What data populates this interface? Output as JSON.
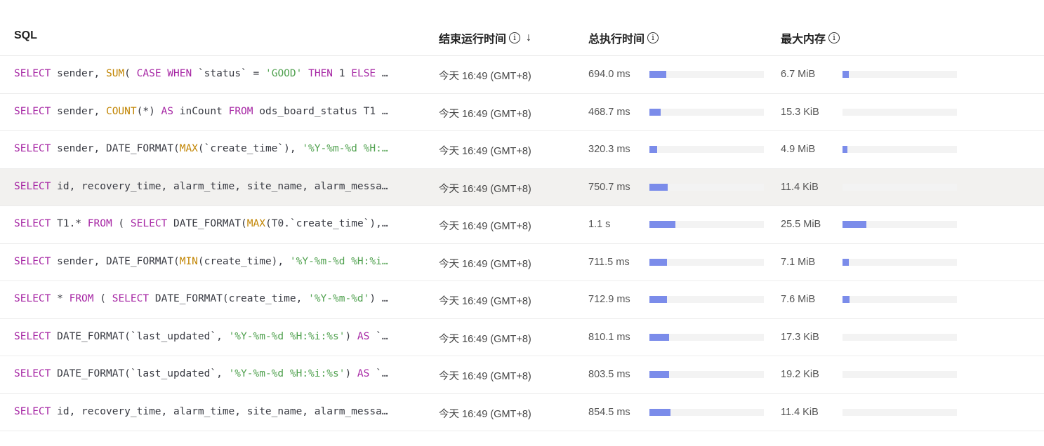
{
  "header": {
    "sql": "SQL",
    "end_time": "结束运行时间",
    "exec_time": "总执行时间",
    "max_mem": "最大内存",
    "info_glyph": "i",
    "sort_glyph": "↓"
  },
  "colors": {
    "keyword": "#a626a4",
    "function": "#c18401",
    "string": "#50a14f",
    "bar": "#7b8cea",
    "track": "#f3f3f3",
    "highlight": "#f2f1ef"
  },
  "rows": [
    {
      "sql": [
        [
          "kw",
          "SELECT"
        ],
        [
          "t",
          " sender, "
        ],
        [
          "fn",
          "SUM"
        ],
        [
          "t",
          "( "
        ],
        [
          "kw",
          "CASE WHEN"
        ],
        [
          "t",
          " `status` = "
        ],
        [
          "str",
          "'GOOD'"
        ],
        [
          "t",
          " "
        ],
        [
          "kw",
          "THEN"
        ],
        [
          "t",
          " 1 "
        ],
        [
          "kw",
          "ELSE"
        ],
        [
          "t",
          " …"
        ]
      ],
      "time": "今天 16:49 (GMT+8)",
      "exec": "694.0 ms",
      "exec_frac": 0.148,
      "mem": "6.7 MiB",
      "mem_frac": 0.055
    },
    {
      "sql": [
        [
          "kw",
          "SELECT"
        ],
        [
          "t",
          " sender, "
        ],
        [
          "fn",
          "COUNT"
        ],
        [
          "t",
          "(*) "
        ],
        [
          "kw",
          "AS"
        ],
        [
          "t",
          " inCount "
        ],
        [
          "kw",
          "FROM"
        ],
        [
          "t",
          " ods_board_status T1 …"
        ]
      ],
      "time": "今天 16:49 (GMT+8)",
      "exec": "468.7 ms",
      "exec_frac": 0.1,
      "mem": "15.3 KiB",
      "mem_frac": 0
    },
    {
      "sql": [
        [
          "kw",
          "SELECT"
        ],
        [
          "t",
          " sender, DATE_FORMAT("
        ],
        [
          "fn",
          "MAX"
        ],
        [
          "t",
          "(`create_time`), "
        ],
        [
          "str",
          "'%Y-%m-%d %H:…"
        ]
      ],
      "time": "今天 16:49 (GMT+8)",
      "exec": "320.3 ms",
      "exec_frac": 0.068,
      "mem": "4.9 MiB",
      "mem_frac": 0.04
    },
    {
      "sql": [
        [
          "kw",
          "SELECT"
        ],
        [
          "t",
          " id, recovery_time, alarm_time, site_name, alarm_messa…"
        ]
      ],
      "time": "今天 16:49 (GMT+8)",
      "exec": "750.7 ms",
      "exec_frac": 0.16,
      "mem": "11.4 KiB",
      "mem_frac": 0,
      "highlight": true
    },
    {
      "sql": [
        [
          "kw",
          "SELECT"
        ],
        [
          "t",
          " T1.* "
        ],
        [
          "kw",
          "FROM"
        ],
        [
          "t",
          " ( "
        ],
        [
          "kw",
          "SELECT"
        ],
        [
          "t",
          " DATE_FORMAT("
        ],
        [
          "fn",
          "MAX"
        ],
        [
          "t",
          "(T0.`create_time`),…"
        ]
      ],
      "time": "今天 16:49 (GMT+8)",
      "exec": "1.1 s",
      "exec_frac": 0.228,
      "mem": "25.5 MiB",
      "mem_frac": 0.21
    },
    {
      "sql": [
        [
          "kw",
          "SELECT"
        ],
        [
          "t",
          " sender, DATE_FORMAT("
        ],
        [
          "fn",
          "MIN"
        ],
        [
          "t",
          "(create_time), "
        ],
        [
          "str",
          "'%Y-%m-%d %H:%i…"
        ]
      ],
      "time": "今天 16:49 (GMT+8)",
      "exec": "711.5 ms",
      "exec_frac": 0.152,
      "mem": "7.1 MiB",
      "mem_frac": 0.058
    },
    {
      "sql": [
        [
          "kw",
          "SELECT"
        ],
        [
          "t",
          " * "
        ],
        [
          "kw",
          "FROM"
        ],
        [
          "t",
          " ( "
        ],
        [
          "kw",
          "SELECT"
        ],
        [
          "t",
          " DATE_FORMAT(create_time, "
        ],
        [
          "str",
          "'%Y-%m-%d'"
        ],
        [
          "t",
          ") …"
        ]
      ],
      "time": "今天 16:49 (GMT+8)",
      "exec": "712.9 ms",
      "exec_frac": 0.152,
      "mem": "7.6 MiB",
      "mem_frac": 0.062
    },
    {
      "sql": [
        [
          "kw",
          "SELECT"
        ],
        [
          "t",
          " DATE_FORMAT(`last_updated`, "
        ],
        [
          "str",
          "'%Y-%m-%d %H:%i:%s'"
        ],
        [
          "t",
          ") "
        ],
        [
          "kw",
          "AS"
        ],
        [
          "t",
          " `…"
        ]
      ],
      "time": "今天 16:49 (GMT+8)",
      "exec": "810.1 ms",
      "exec_frac": 0.172,
      "mem": "17.3 KiB",
      "mem_frac": 0
    },
    {
      "sql": [
        [
          "kw",
          "SELECT"
        ],
        [
          "t",
          " DATE_FORMAT(`last_updated`, "
        ],
        [
          "str",
          "'%Y-%m-%d %H:%i:%s'"
        ],
        [
          "t",
          ") "
        ],
        [
          "kw",
          "AS"
        ],
        [
          "t",
          " `…"
        ]
      ],
      "time": "今天 16:49 (GMT+8)",
      "exec": "803.5 ms",
      "exec_frac": 0.171,
      "mem": "19.2 KiB",
      "mem_frac": 0
    },
    {
      "sql": [
        [
          "kw",
          "SELECT"
        ],
        [
          "t",
          " id, recovery_time, alarm_time, site_name, alarm_messa…"
        ]
      ],
      "time": "今天 16:49 (GMT+8)",
      "exec": "854.5 ms",
      "exec_frac": 0.182,
      "mem": "11.4 KiB",
      "mem_frac": 0
    }
  ]
}
